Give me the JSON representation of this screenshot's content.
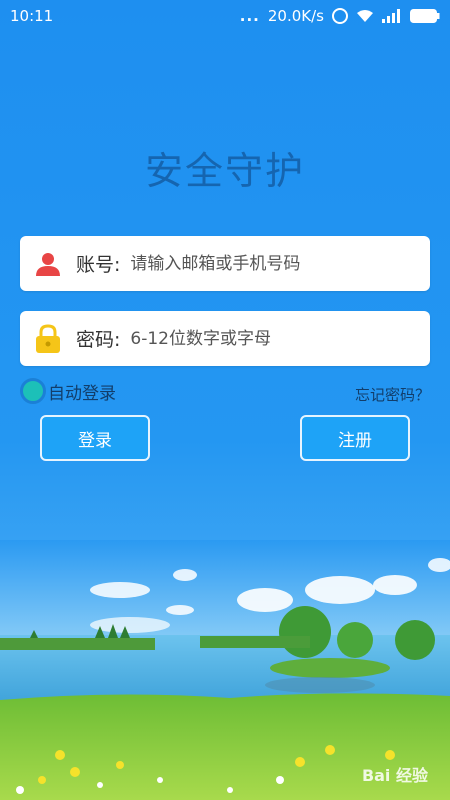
{
  "status_bar": {
    "time": "10:11",
    "dots": "...",
    "network_speed": "20.0K/s",
    "icons": [
      "alarm-icon",
      "wifi-icon",
      "signal-icon",
      "battery-icon"
    ]
  },
  "app": {
    "title": "安全守护"
  },
  "account_field": {
    "label": "账号:",
    "placeholder": "请输入邮箱或手机号码",
    "value": "",
    "icon": "user-icon",
    "icon_color": "#e84545"
  },
  "password_field": {
    "label": "密码:",
    "placeholder": "6-12位数字或字母",
    "value": "",
    "icon": "lock-icon",
    "icon_color": "#f5c518"
  },
  "options": {
    "auto_login_label": "自动登录",
    "forgot_password_label": "忘记密码？"
  },
  "buttons": {
    "login_label": "登录",
    "register_label": "注册"
  },
  "watermark": {
    "text": "Bai 经验"
  },
  "colors": {
    "background": "#1e8ff0",
    "title": "#1565b0",
    "button": "#1ea3f7",
    "radio": "#1cc0b8"
  }
}
